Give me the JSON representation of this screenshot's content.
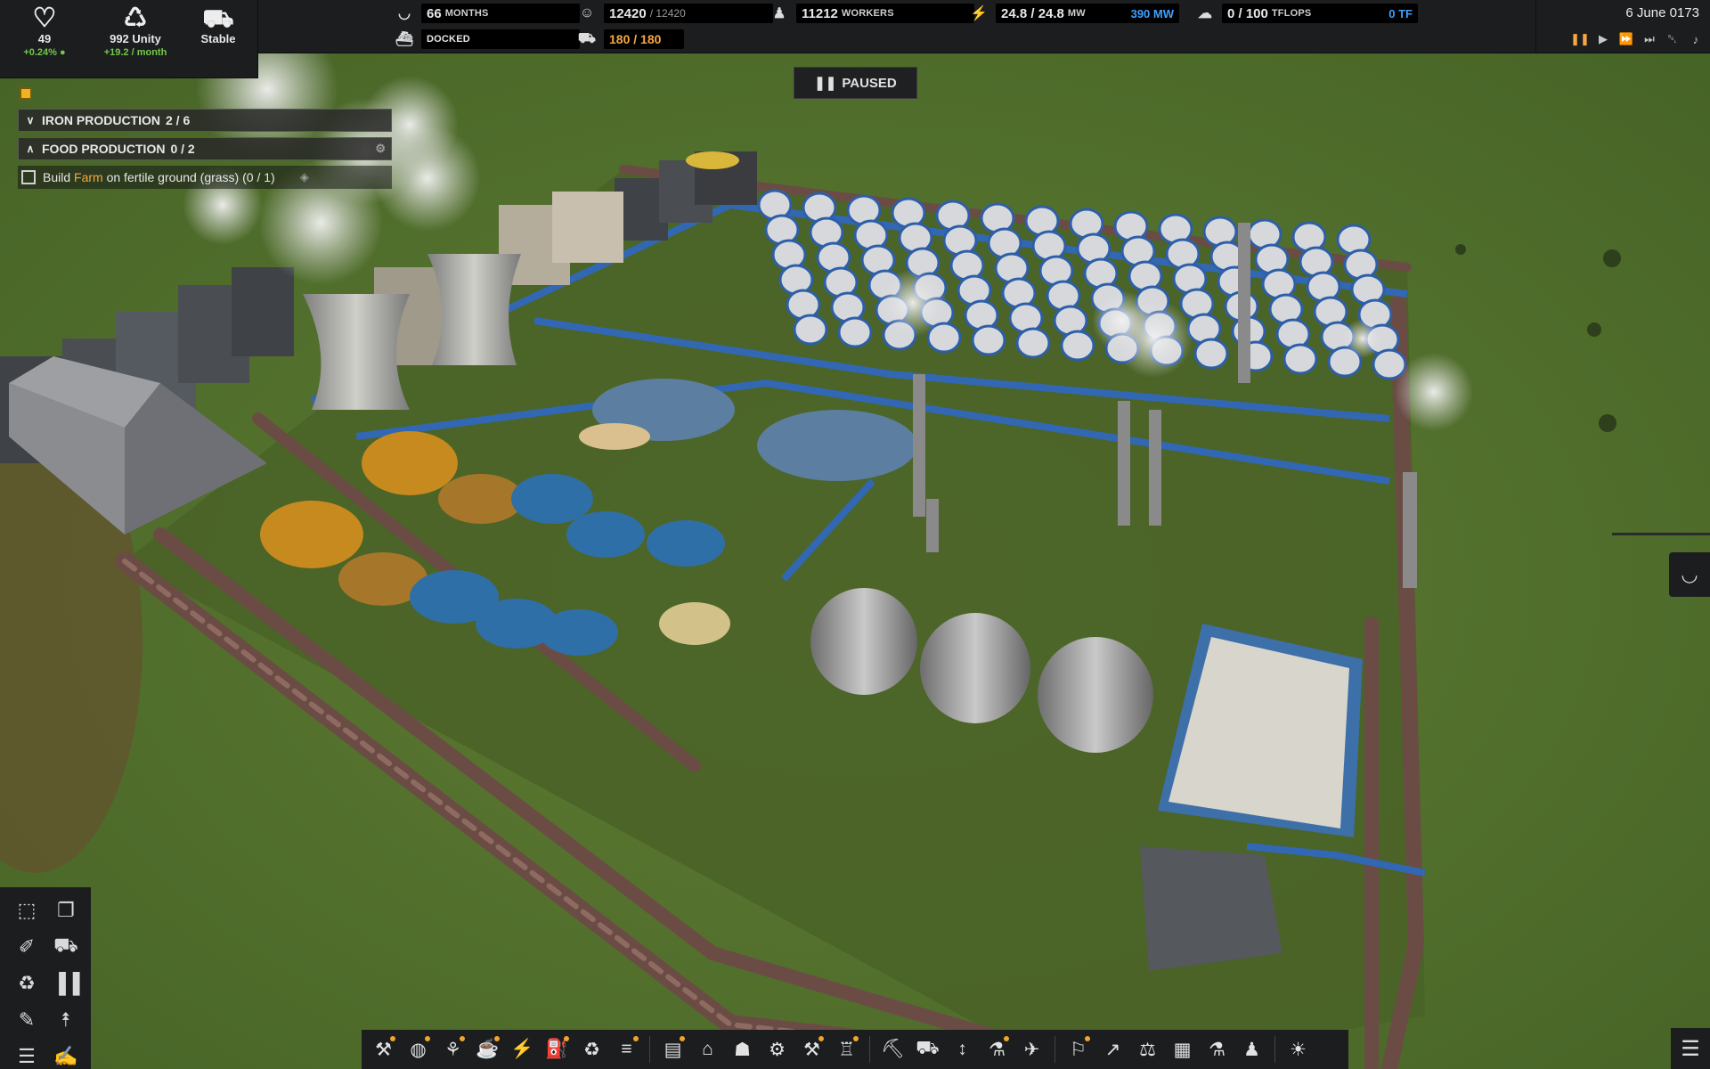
{
  "hud": {
    "health": {
      "icon": "heart-icon",
      "value": "49",
      "change": "+0.24%"
    },
    "unity": {
      "icon": "unity-icon",
      "value": "992 Unity",
      "change": "+19.2 / month"
    },
    "status": {
      "icon": "truck-icon",
      "value": "Stable"
    }
  },
  "stats": {
    "food": {
      "icon": "food-bowl-icon",
      "value": "66",
      "unit": "MONTHS"
    },
    "ship": {
      "icon": "ship-icon",
      "value": "DOCKED"
    },
    "population": {
      "icon": "people-icon",
      "value": "12420",
      "capacity": "/ 12420"
    },
    "vehicles": {
      "icon": "vehicle-icon",
      "value": "180 / 180"
    },
    "workers": {
      "icon": "worker-icon",
      "value": "11212",
      "unit": "WORKERS"
    },
    "electricity": {
      "icon": "lightning-icon",
      "value": "24.8 / 24.8",
      "unit": "MW",
      "capacity": "390 MW"
    },
    "computing": {
      "icon": "cloud-icon",
      "value": "0 / 100",
      "unit": "TFLOPS",
      "capacity": "0 TF"
    }
  },
  "date": "6 June 0173",
  "speed_controls": [
    {
      "icon": "pause-icon",
      "active": true
    },
    {
      "icon": "play-icon",
      "active": false
    },
    {
      "icon": "fast-forward-icon",
      "active": false
    },
    {
      "icon": "fastest-forward-icon",
      "active": false
    },
    {
      "icon": "bell-muted-icon",
      "active": false
    },
    {
      "icon": "sound-icon",
      "active": false
    }
  ],
  "paused_label": "PAUSED",
  "goals": [
    {
      "title": "IRON PRODUCTION",
      "progress": "2 / 6",
      "expanded": false
    },
    {
      "title": "FOOD PRODUCTION",
      "progress": "0 / 2",
      "expanded": true,
      "task": {
        "prefix": "Build ",
        "highlight": "Farm",
        "suffix": " on fertile ground (grass) (0 / 1)"
      }
    }
  ],
  "tools": [
    {
      "icon": "selection-icon"
    },
    {
      "icon": "copy-icon"
    },
    {
      "icon": "eyedropper-icon"
    },
    {
      "icon": "bulldozer-icon"
    },
    {
      "icon": "recycle-icon"
    },
    {
      "icon": "pause-buildings-icon"
    },
    {
      "icon": "brush-icon"
    },
    {
      "icon": "priority-up-icon"
    },
    {
      "icon": "layers-icon"
    },
    {
      "icon": "edit-icon",
      "selected": true
    }
  ],
  "bottom_toolbar": [
    {
      "icon": "mine-icon",
      "dot": true
    },
    {
      "icon": "water-icon",
      "dot": true
    },
    {
      "icon": "farm-icon",
      "dot": true
    },
    {
      "icon": "food-processing-icon",
      "dot": true
    },
    {
      "icon": "power-icon",
      "dot": false
    },
    {
      "icon": "fuel-icon",
      "dot": true
    },
    {
      "icon": "waste-icon",
      "dot": false
    },
    {
      "icon": "conveyor-icon",
      "dot": true,
      "sep_after": true
    },
    {
      "icon": "storage-icon",
      "dot": true
    },
    {
      "icon": "factory-icon",
      "dot": false
    },
    {
      "icon": "warehouse-icon",
      "dot": false
    },
    {
      "icon": "machine-icon",
      "dot": false
    },
    {
      "icon": "assembly-icon",
      "dot": true
    },
    {
      "icon": "tower-icon",
      "dot": true,
      "sep_after": true
    },
    {
      "icon": "excavator-icon",
      "dot": false
    },
    {
      "icon": "truck-icon",
      "dot": false
    },
    {
      "icon": "transport-icon",
      "dot": false
    },
    {
      "icon": "research-icon",
      "dot": true
    },
    {
      "icon": "rocket-icon",
      "dot": false,
      "sep_after": true
    },
    {
      "icon": "learn-icon",
      "dot": true
    },
    {
      "icon": "stats-icon",
      "dot": false
    },
    {
      "icon": "balance-icon",
      "dot": false
    },
    {
      "icon": "recipes-icon",
      "dot": false
    },
    {
      "icon": "flask-icon",
      "dot": false
    },
    {
      "icon": "population-icon",
      "dot": false,
      "sep_after": true
    },
    {
      "icon": "settings-sun-icon",
      "dot": false
    }
  ],
  "colors": {
    "accent": "#f5a742",
    "electric_blue": "#3fa1ff",
    "positive": "#73c94b",
    "panel": "#1b1d1f",
    "grass": "#4e6a2c"
  }
}
